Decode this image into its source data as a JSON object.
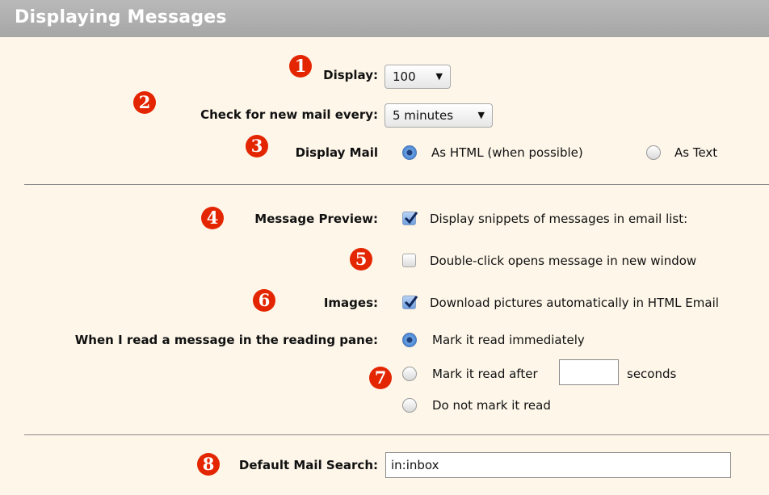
{
  "header": {
    "title": "Displaying Messages"
  },
  "markers": [
    "1",
    "2",
    "3",
    "4",
    "5",
    "6",
    "7",
    "8"
  ],
  "display": {
    "label": "Display:",
    "value": "100"
  },
  "check_mail": {
    "label": "Check for new mail every:",
    "value": "5 minutes"
  },
  "display_mail": {
    "label": "Display Mail",
    "options": [
      {
        "label": "As HTML (when possible)",
        "selected": true
      },
      {
        "label": "As Text",
        "selected": false
      }
    ]
  },
  "message_preview": {
    "label": "Message Preview:",
    "option": "Display snippets of messages in email list:",
    "checked": true
  },
  "double_click": {
    "option": "Double-click opens message in new window",
    "checked": false
  },
  "images": {
    "label": "Images:",
    "option": "Download pictures automatically in HTML Email",
    "checked": true
  },
  "reading_pane": {
    "label": "When I read a message in the reading pane:",
    "options": [
      {
        "label": "Mark it read immediately",
        "selected": true
      },
      {
        "label": "Mark it read after",
        "selected": false
      },
      {
        "label": "Do not mark it read",
        "selected": false
      }
    ],
    "seconds_value": "",
    "seconds_label": "seconds"
  },
  "default_search": {
    "label": "Default Mail Search:",
    "value": "in:inbox"
  },
  "colors": {
    "marker": "#e32600",
    "header": "#a9a9a9",
    "panel_bg": "#fdf6e9"
  },
  "icons": {
    "dropdown": "chevron-down-icon",
    "check": "checkmark-icon"
  }
}
